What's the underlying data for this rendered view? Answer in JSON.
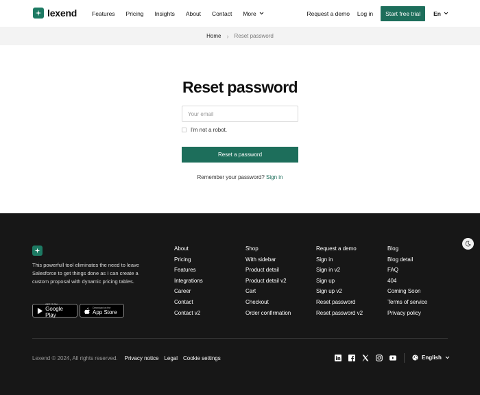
{
  "brand": {
    "name": "lexend",
    "accent": "#1d6e5b"
  },
  "nav": {
    "items": [
      {
        "label": "Features"
      },
      {
        "label": "Pricing"
      },
      {
        "label": "Insights"
      },
      {
        "label": "About"
      },
      {
        "label": "Contact"
      },
      {
        "label": "More"
      }
    ],
    "request_demo": "Request a demo",
    "login": "Log in",
    "trial": "Start free trial",
    "language": "En"
  },
  "breadcrumb": {
    "home": "Home",
    "current": "Reset password"
  },
  "form": {
    "title": "Reset password",
    "email_placeholder": "Your email",
    "robot_label": "I'm not a robot.",
    "submit_label": "Reset a password",
    "remember_text": "Remember your password?",
    "signin_link": "Sign in"
  },
  "footer": {
    "description": "This powerfull tool eliminates the need to leave Salesforce to get things done as I can create a custom proposal with dynamic pricing tables.",
    "google_play": {
      "small": "GET IT ON",
      "big": "Google Play"
    },
    "app_store": {
      "small": "Download on the",
      "big": "App Store"
    },
    "columns": [
      [
        "About",
        "Pricing",
        "Features",
        "Integrations",
        "Career",
        "Contact",
        "Contact v2"
      ],
      [
        "Shop",
        "With sidebar",
        "Product detail",
        "Product detail v2",
        "Cart",
        "Checkout",
        "Order confirmation"
      ],
      [
        "Request a demo",
        "Sign in",
        "Sign in v2",
        "Sign up",
        "Sign up v2",
        "Reset password",
        "Reset password v2"
      ],
      [
        "Blog",
        "Blog detail",
        "FAQ",
        "404",
        "Coming Soon",
        "Terms of service",
        "Privacy policy"
      ]
    ],
    "copyright": "Lexend © 2024, All rights reserved.",
    "legal_links": [
      "Privacy notice",
      "Legal",
      "Cookie settings"
    ],
    "social_icons": [
      "linkedin-icon",
      "facebook-icon",
      "x-icon",
      "instagram-icon",
      "youtube-icon"
    ],
    "language": "English"
  }
}
